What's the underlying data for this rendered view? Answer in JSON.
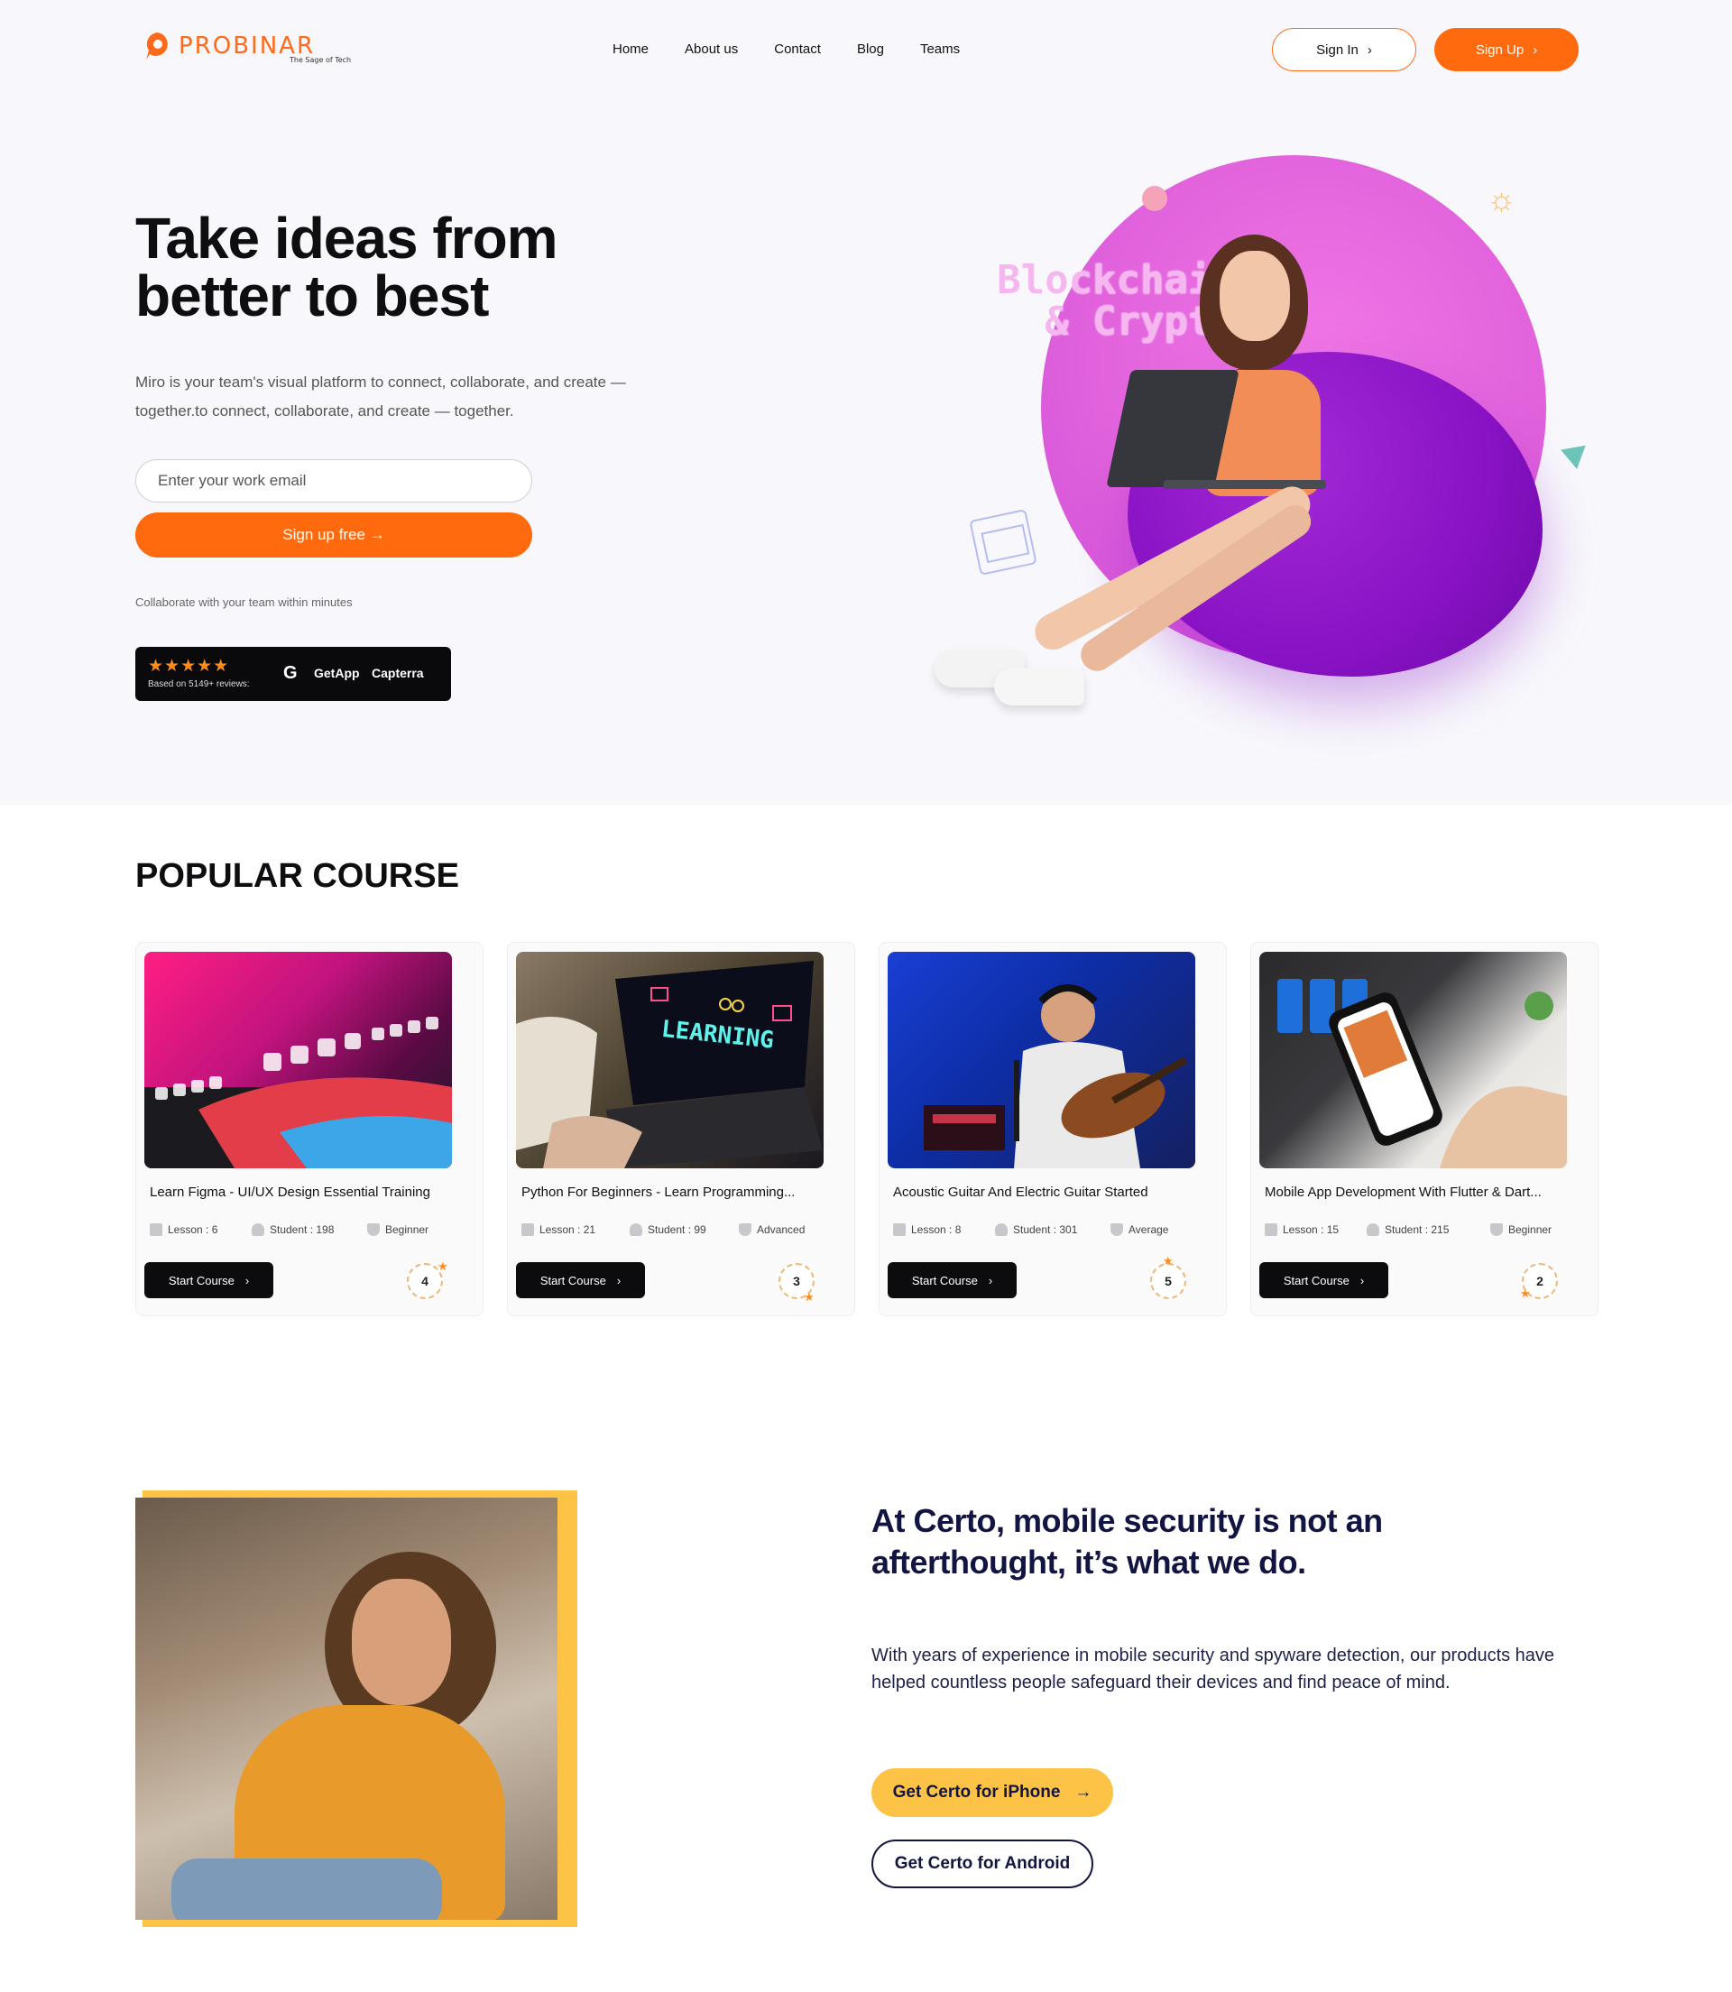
{
  "brand": {
    "name": "PROBINAR",
    "tagline": "The Sage of Tech",
    "accent": "#ff6a0e"
  },
  "nav": {
    "items": [
      "Home",
      "About us",
      "Contact",
      "Blog",
      "Teams"
    ]
  },
  "header": {
    "sign_in": "Sign In",
    "sign_up": "Sign Up"
  },
  "hero": {
    "title": "Take ideas from better to best",
    "description": "Miro is your team's visual platform to connect, collaborate, and create — together.to connect, collaborate, and create — together.",
    "email_placeholder": "Enter your work email",
    "cta": "Sign up free →",
    "collab_note": "Collaborate with your team within minutes",
    "reviews": {
      "stars": "★★★★★",
      "rating": 4.5,
      "based_on": "Based on 5149+ reviews:",
      "platform1": "GetApp",
      "platform2": "Capterra"
    },
    "art_text": "Blockchain & Crypto"
  },
  "popular": {
    "title": "POPULAR COURSE",
    "courses": [
      {
        "title": "Learn Figma - UI/UX Design Essential Training",
        "lesson": "Lesson : 6",
        "student": "Student : 198",
        "level": "Beginner",
        "button": "Start Course",
        "rating": "4"
      },
      {
        "title": "Python For Beginners - Learn Programming...",
        "lesson": "Lesson : 21",
        "student": "Student : 99",
        "level": "Advanced",
        "button": "Start Course",
        "rating": "3"
      },
      {
        "title": "Acoustic Guitar And Electric Guitar Started",
        "lesson": "Lesson : 8",
        "student": "Student : 301",
        "level": "Average",
        "button": "Start Course",
        "rating": "5"
      },
      {
        "title": "Mobile App Development With Flutter & Dart...",
        "lesson": "Lesson : 15",
        "student": "Student : 215",
        "level": "Beginner",
        "button": "Start Course",
        "rating": "2"
      }
    ]
  },
  "certo": {
    "title": "At Certo, mobile security is not an afterthought, it’s what we do.",
    "description": "With years of experience in mobile security and spyware detection, our products have helped countless people safeguard their devices and find peace of mind.",
    "btn_iphone": "Get Certo for iPhone",
    "btn_android": "Get Certo for Android",
    "accent": "#fdc347",
    "navy": "#121541"
  }
}
